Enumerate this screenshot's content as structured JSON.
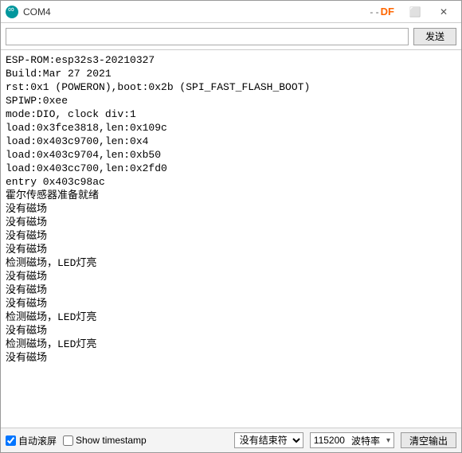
{
  "titlebar": {
    "title": "COM4",
    "brand": "DF",
    "dash": "- -",
    "maximize_icon": "⬜",
    "close_icon": "✕"
  },
  "sendbar": {
    "input_value": "",
    "send_label": "发送"
  },
  "console_lines": [
    "ESP-ROM:esp32s3-20210327",
    "Build:Mar 27 2021",
    "rst:0x1 (POWERON),boot:0x2b (SPI_FAST_FLASH_BOOT)",
    "SPIWP:0xee",
    "mode:DIO, clock div:1",
    "load:0x3fce3818,len:0x109c",
    "load:0x403c9700,len:0x4",
    "load:0x403c9704,len:0xb50",
    "load:0x403cc700,len:0x2fd0",
    "entry 0x403c98ac",
    "霍尔传感器准备就绪",
    "没有磁场",
    "没有磁场",
    "没有磁场",
    "没有磁场",
    "检测磁场，LED灯亮",
    "没有磁场",
    "没有磁场",
    "没有磁场",
    "检测磁场，LED灯亮",
    "没有磁场",
    "检测磁场，LED灯亮",
    "没有磁场"
  ],
  "footer": {
    "autoscroll_label": "自动滚屏",
    "autoscroll_checked": true,
    "timestamp_label": "Show timestamp",
    "timestamp_checked": false,
    "line_ending_selected": "没有结束符",
    "baud_value": "115200",
    "baud_label": "波特率",
    "clear_label": "清空输出"
  }
}
